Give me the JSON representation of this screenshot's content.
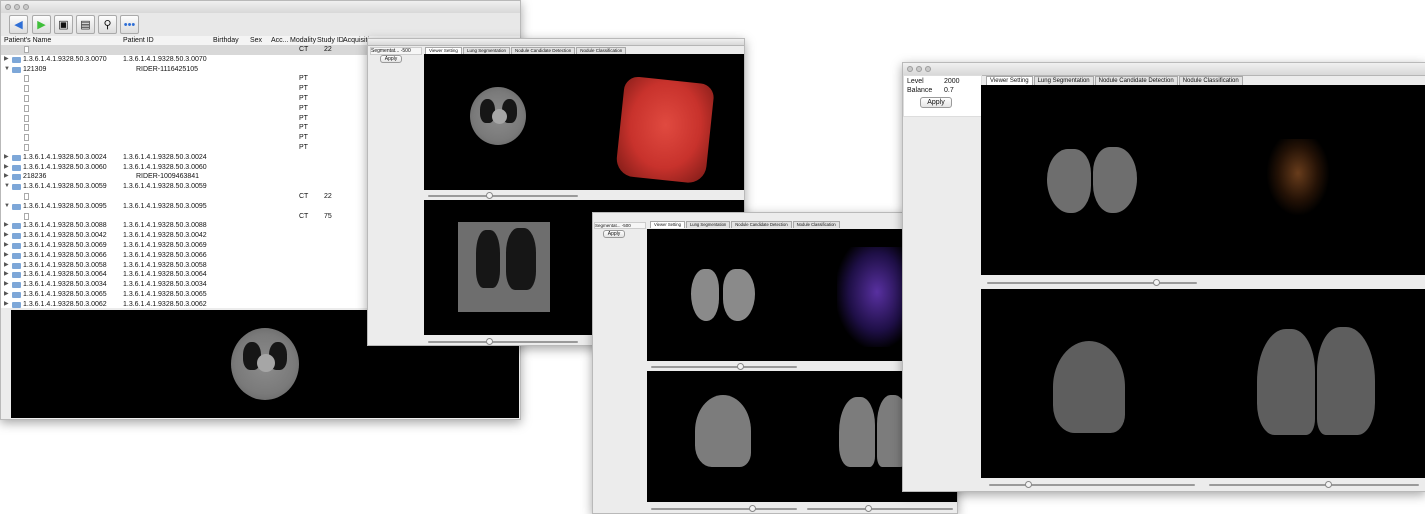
{
  "browser": {
    "columns": [
      "Patient's Name",
      "Patient ID",
      "Birthday",
      "Sex",
      "Acc...",
      "Modality",
      "Study ID",
      "Acquisitio"
    ],
    "rows": [
      {
        "type": "doc",
        "name": "",
        "pid": "",
        "mod": "CT",
        "study": "22",
        "selected": true
      },
      {
        "type": "folder",
        "exp": "▶",
        "name": "1.3.6.1.4.1.9328.50.3.0070",
        "pid": "1.3.6.1.4.1.9328.50.3.0070",
        "mod": "",
        "study": ""
      },
      {
        "type": "folder",
        "exp": "▼",
        "name": "121309",
        "pid": "RIDER-1116425105",
        "mod": "",
        "study": ""
      },
      {
        "type": "doc",
        "name": "",
        "pid": "",
        "mod": "PT",
        "study": ""
      },
      {
        "type": "doc",
        "name": "",
        "pid": "",
        "mod": "PT",
        "study": ""
      },
      {
        "type": "doc",
        "name": "",
        "pid": "",
        "mod": "PT",
        "study": ""
      },
      {
        "type": "doc",
        "name": "",
        "pid": "",
        "mod": "PT",
        "study": ""
      },
      {
        "type": "doc",
        "name": "",
        "pid": "",
        "mod": "PT",
        "study": ""
      },
      {
        "type": "doc",
        "name": "",
        "pid": "",
        "mod": "PT",
        "study": ""
      },
      {
        "type": "doc",
        "name": "",
        "pid": "",
        "mod": "PT",
        "study": ""
      },
      {
        "type": "doc",
        "name": "",
        "pid": "",
        "mod": "PT",
        "study": ""
      },
      {
        "type": "folder",
        "exp": "▶",
        "name": "1.3.6.1.4.1.9328.50.3.0024",
        "pid": "1.3.6.1.4.1.9328.50.3.0024",
        "mod": "",
        "study": ""
      },
      {
        "type": "folder",
        "exp": "▶",
        "name": "1.3.6.1.4.1.9328.50.3.0060",
        "pid": "1.3.6.1.4.1.9328.50.3.0060",
        "mod": "",
        "study": ""
      },
      {
        "type": "folder",
        "exp": "▶",
        "name": "218236",
        "pid": "RIDER-1009463841",
        "mod": "",
        "study": ""
      },
      {
        "type": "folder",
        "exp": "▼",
        "name": "1.3.6.1.4.1.9328.50.3.0059",
        "pid": "1.3.6.1.4.1.9328.50.3.0059",
        "mod": "",
        "study": ""
      },
      {
        "type": "doc",
        "name": "",
        "pid": "",
        "mod": "CT",
        "study": "22"
      },
      {
        "type": "folder",
        "exp": "▼",
        "name": "1.3.6.1.4.1.9328.50.3.0095",
        "pid": "1.3.6.1.4.1.9328.50.3.0095",
        "mod": "",
        "study": ""
      },
      {
        "type": "doc",
        "name": "",
        "pid": "",
        "mod": "CT",
        "study": "75"
      },
      {
        "type": "folder",
        "exp": "▶",
        "name": "1.3.6.1.4.1.9328.50.3.0088",
        "pid": "1.3.6.1.4.1.9328.50.3.0088",
        "mod": "",
        "study": ""
      },
      {
        "type": "folder",
        "exp": "▶",
        "name": "1.3.6.1.4.1.9328.50.3.0042",
        "pid": "1.3.6.1.4.1.9328.50.3.0042",
        "mod": "",
        "study": ""
      },
      {
        "type": "folder",
        "exp": "▶",
        "name": "1.3.6.1.4.1.9328.50.3.0069",
        "pid": "1.3.6.1.4.1.9328.50.3.0069",
        "mod": "",
        "study": ""
      },
      {
        "type": "folder",
        "exp": "▶",
        "name": "1.3.6.1.4.1.9328.50.3.0066",
        "pid": "1.3.6.1.4.1.9328.50.3.0066",
        "mod": "",
        "study": ""
      },
      {
        "type": "folder",
        "exp": "▶",
        "name": "1.3.6.1.4.1.9328.50.3.0058",
        "pid": "1.3.6.1.4.1.9328.50.3.0058",
        "mod": "",
        "study": ""
      },
      {
        "type": "folder",
        "exp": "▶",
        "name": "1.3.6.1.4.1.9328.50.3.0064",
        "pid": "1.3.6.1.4.1.9328.50.3.0064",
        "mod": "",
        "study": ""
      },
      {
        "type": "folder",
        "exp": "▶",
        "name": "1.3.6.1.4.1.9328.50.3.0034",
        "pid": "1.3.6.1.4.1.9328.50.3.0034",
        "mod": "",
        "study": ""
      },
      {
        "type": "folder",
        "exp": "▶",
        "name": "1.3.6.1.4.1.9328.50.3.0065",
        "pid": "1.3.6.1.4.1.9328.50.3.0065",
        "mod": "",
        "study": ""
      },
      {
        "type": "folder",
        "exp": "▶",
        "name": "1.3.6.1.4.1.9328.50.3.0062",
        "pid": "1.3.6.1.4.1.9328.50.3.0062",
        "mod": "",
        "study": ""
      }
    ],
    "toolbar_icons": [
      "back-arrow-icon",
      "forward-arrow-icon",
      "film-icon",
      "document-icon",
      "magnifier-icon",
      "more-icon"
    ]
  },
  "win2": {
    "seg_label": "Segmentat... -500",
    "apply": "Apply",
    "tabs": [
      "Viewer Setting",
      "Lung Segmentation",
      "Nodule Candidate Detection",
      "Nodule Classification"
    ]
  },
  "win3": {
    "seg_label": "Segmentat... -500",
    "apply": "Apply",
    "tabs": [
      "Viewer Setting",
      "Lung Segmentation",
      "Nodule Candidate Detection",
      "Nodule Classification"
    ]
  },
  "win4": {
    "level_label": "Level",
    "level_value": "2000",
    "balance_label": "Balance",
    "balance_value": "0.7",
    "apply": "Apply",
    "tabs": [
      "Viewer Setting",
      "Lung Segmentation",
      "Nodule Candidate Detection",
      "Nodule Classification"
    ]
  },
  "colors": {
    "toolbar_blue": "#2f6fd6",
    "toolbar_green": "#3fbf3a",
    "volume_red": "#c8322c",
    "folder": "#7da7d8"
  }
}
